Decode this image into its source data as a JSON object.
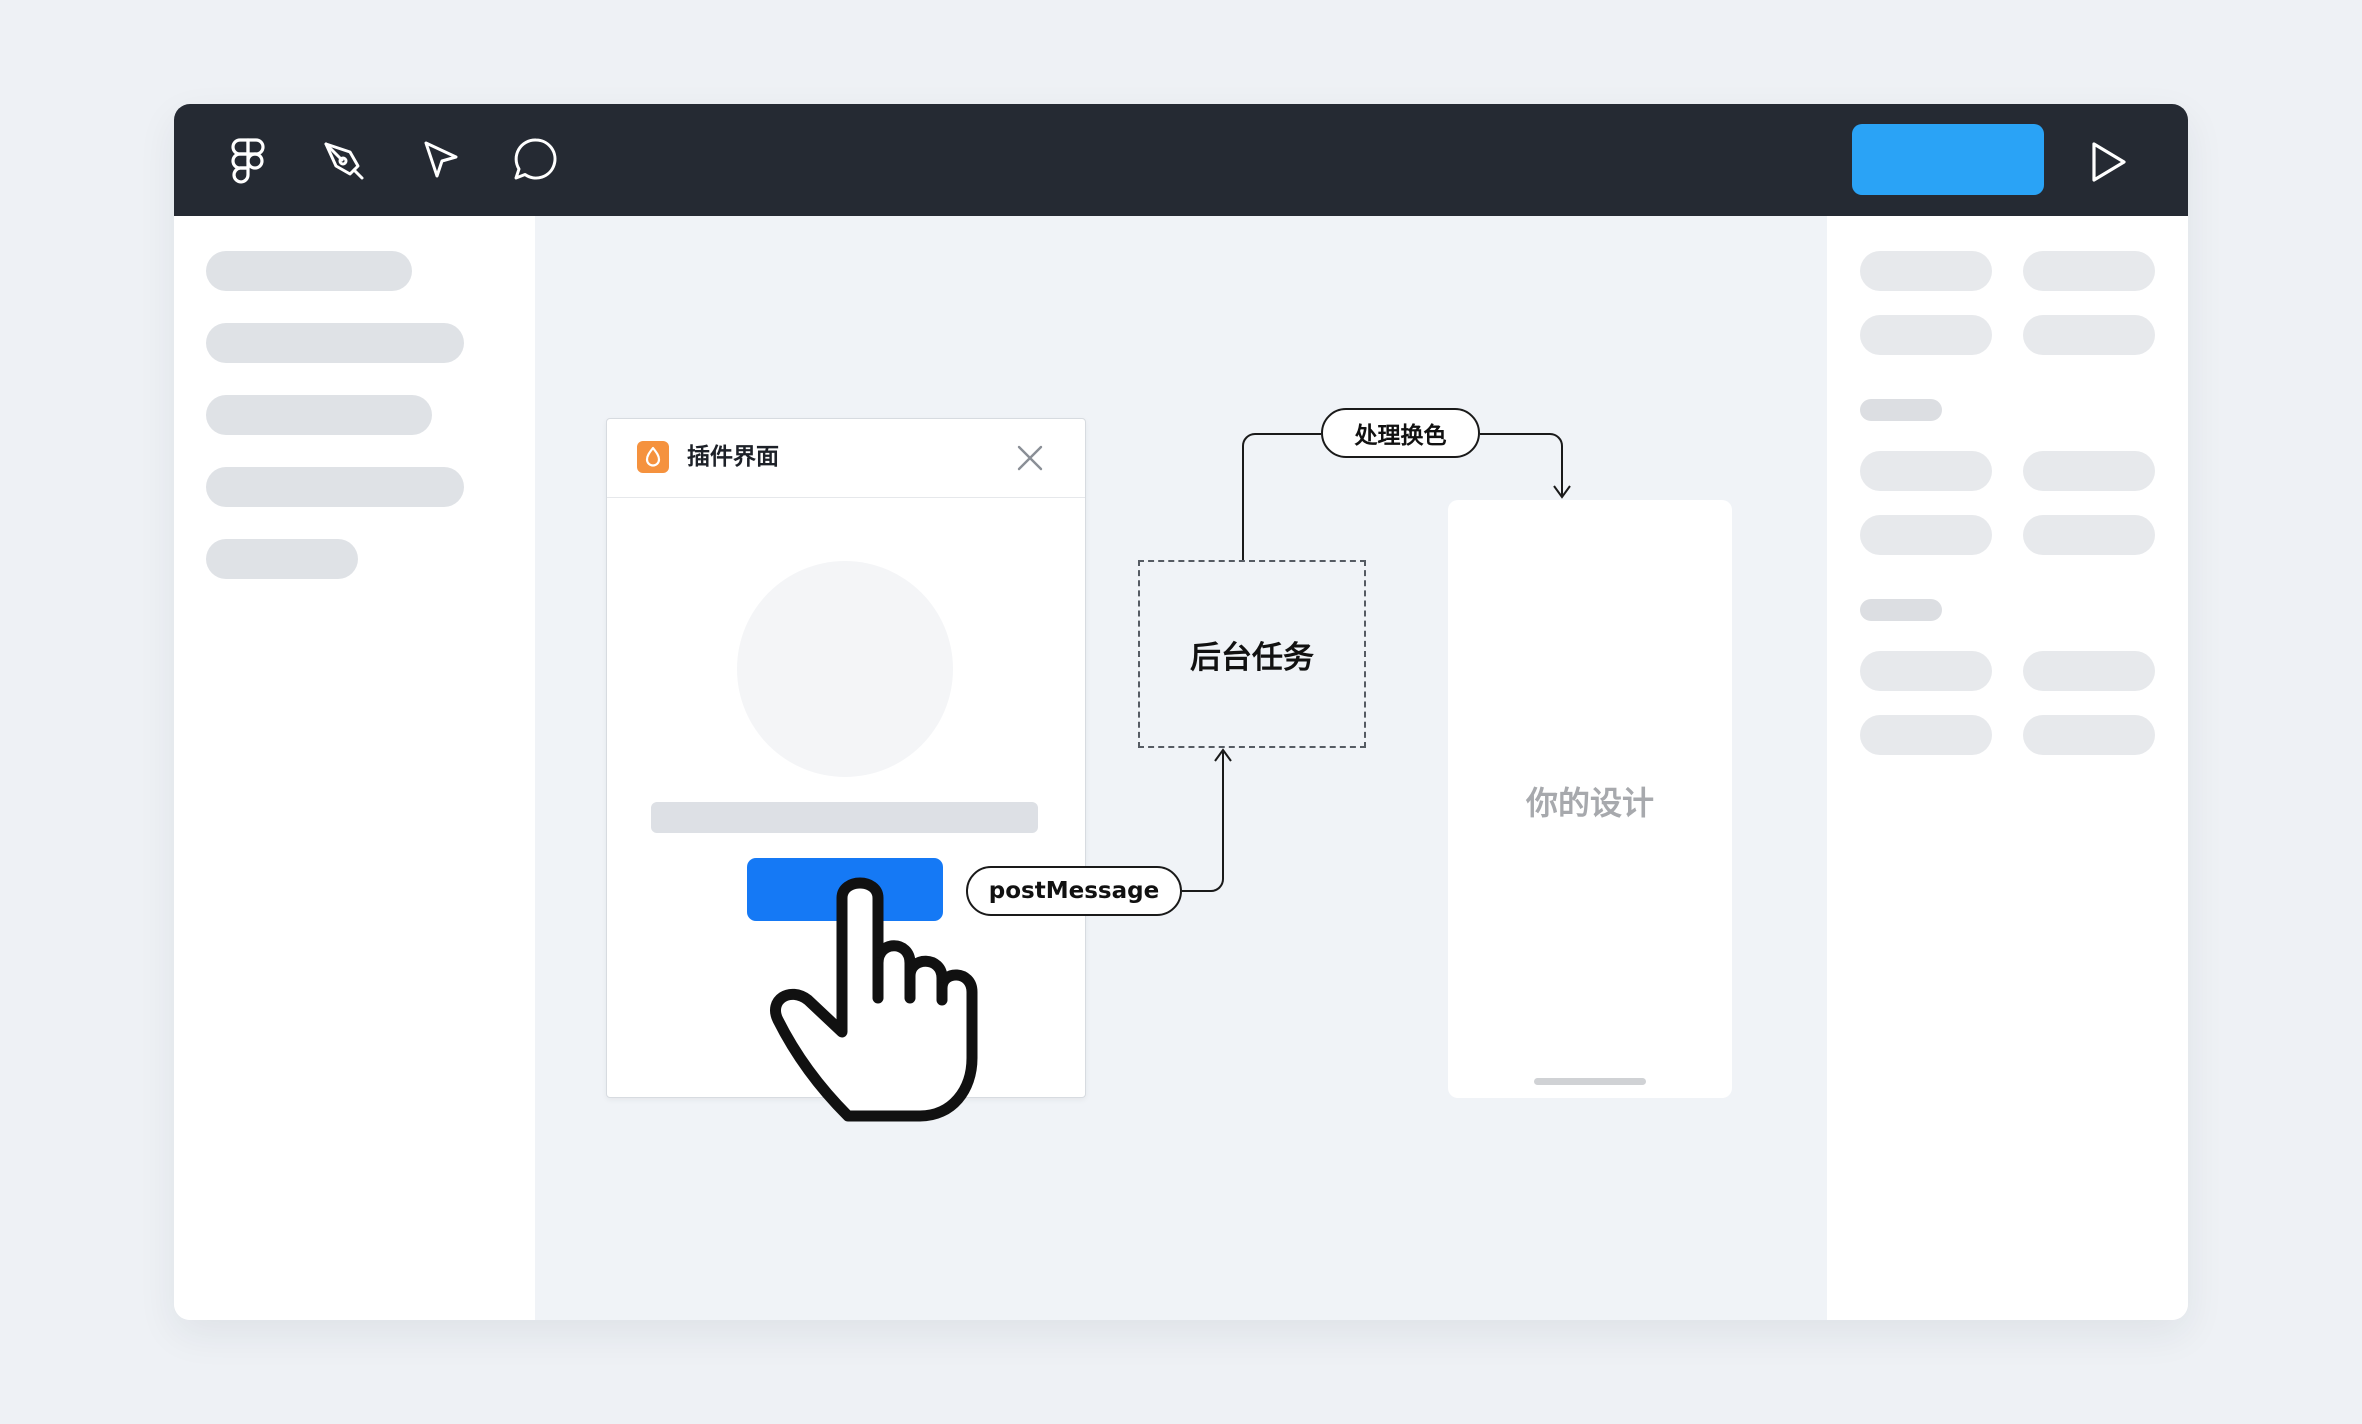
{
  "toolbar": {
    "icons": [
      "figma-logo-icon",
      "pen-tool-icon",
      "pointer-icon",
      "comment-icon"
    ],
    "share_button_label": "",
    "play_icon": "play-icon",
    "background_color": "#252a33",
    "accent_color": "#2aa3f6"
  },
  "plugin_window": {
    "title": "插件界面",
    "logo_icon": "droplet-icon",
    "logo_color": "#f5923e",
    "close_icon": "close-icon",
    "button_color": "#1579f5"
  },
  "diagram": {
    "background_task_label": "后台任务",
    "recolor_label": "处理换色",
    "post_message_label": "postMessage"
  },
  "design_frame": {
    "label": "你的设计"
  },
  "cursor": {
    "icon": "hand-pointer-icon"
  }
}
